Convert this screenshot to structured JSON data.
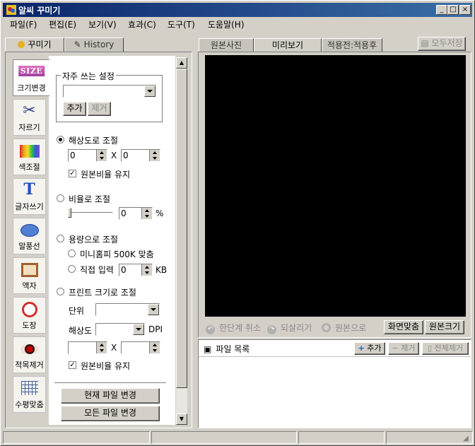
{
  "window": {
    "title": "알씨 꾸미기"
  },
  "menu": [
    "파일(F)",
    "편집(E)",
    "보기(V)",
    "효과(C)",
    "도구(T)",
    "도움말(H)"
  ],
  "left_tabs": {
    "decorate": "꾸미기",
    "history": "History"
  },
  "tools": [
    {
      "label": "크기변경",
      "icon": "size-icon"
    },
    {
      "label": "자르기",
      "icon": "scissors-icon"
    },
    {
      "label": "색조절",
      "icon": "color-bars-icon"
    },
    {
      "label": "글자쓰기",
      "icon": "text-icon"
    },
    {
      "label": "말풍선",
      "icon": "speech-bubble-icon"
    },
    {
      "label": "액자",
      "icon": "frame-icon"
    },
    {
      "label": "도장",
      "icon": "stamp-icon"
    },
    {
      "label": "적목제거",
      "icon": "red-eye-icon"
    },
    {
      "label": "수평맞춤",
      "icon": "level-grid-icon"
    }
  ],
  "size_panel": {
    "size_logo": "SIZE",
    "favorites_label": "자주 쓰는 설정",
    "add_button": "추가",
    "remove_button": "제거",
    "by_resolution": "해상도로 조절",
    "width_value": "0",
    "height_value": "0",
    "x_sep": "X",
    "keep_ratio": "원본비율 유지",
    "by_ratio": "비율로 조절",
    "ratio_value": "0",
    "percent": "%",
    "by_capacity": "용량으로 조절",
    "minihompy": "미니홈피 500K 맞춤",
    "direct_input": "직접 입력",
    "kb_value": "0",
    "kb_unit": "KB",
    "by_print": "프린트 크기로 조절",
    "unit_label": "단위",
    "resolution_label": "해상도",
    "dpi": "DPI",
    "x_sep2": "X",
    "keep_ratio2": "원본비율 유지",
    "apply_current": "현재 파일 변경",
    "apply_all": "모든 파일 변경"
  },
  "right_tabs": {
    "original": "원본사진",
    "preview": "미리보기",
    "before_after": "적용전:적용후"
  },
  "save_all": "모두저장",
  "preview_bar": {
    "undo": "한단계 취소",
    "redo": "되살리기",
    "revert": "원본으로",
    "fit": "화면맞춤",
    "actual": "원본크기"
  },
  "file_list": {
    "title": "파일 목록",
    "add": "추가",
    "remove": "제거",
    "remove_all": "전체제거"
  }
}
